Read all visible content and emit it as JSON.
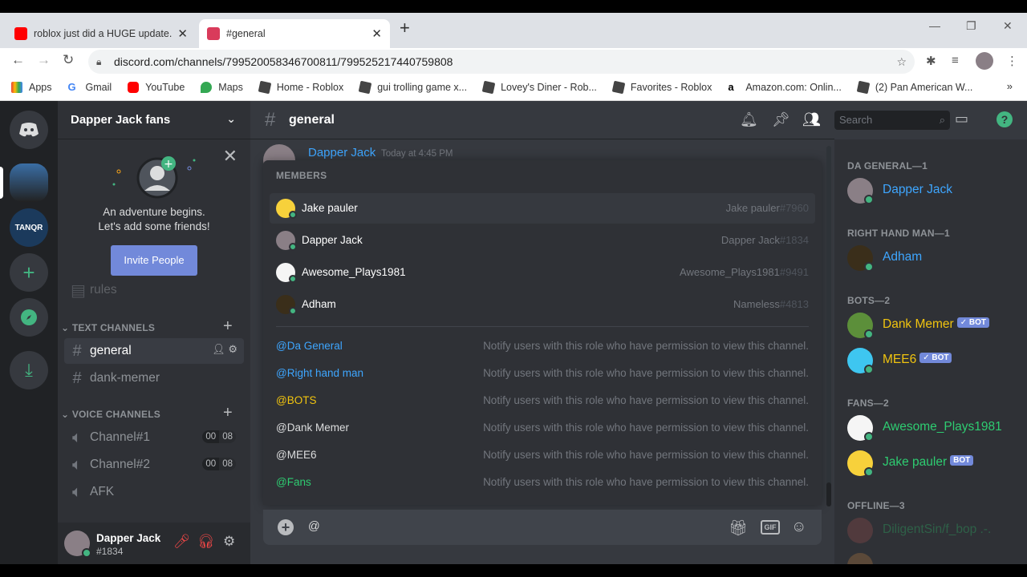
{
  "browser": {
    "tabs": [
      {
        "title": "roblox just did a HUGE update...",
        "favicon_color": "#ff0000",
        "active": false
      },
      {
        "title": "#general",
        "favicon_color": "#d93b5b",
        "active": true
      }
    ],
    "url": "discord.com/channels/799520058346700811/799525217440759808",
    "bookmarks": [
      "Apps",
      "Gmail",
      "YouTube",
      "Maps",
      "Home - Roblox",
      "gui trolling game x...",
      "Lovey's Diner - Rob...",
      "Favorites - Roblox",
      "Amazon.com: Onlin...",
      "(2) Pan American W..."
    ],
    "bookmarks_more": "»"
  },
  "server": {
    "name": "Dapper Jack fans",
    "invite": {
      "line1": "An adventure begins.",
      "line2": "Let's add some friends!",
      "button": "Invite People"
    },
    "partial_channel": "rules",
    "text_category": "TEXT CHANNELS",
    "text_channels": [
      "general",
      "dank-memer"
    ],
    "voice_category": "VOICE CHANNELS",
    "voice_channels": [
      {
        "name": "Channel#1",
        "count_a": "00",
        "count_b": "08"
      },
      {
        "name": "Channel#2",
        "count_a": "00",
        "count_b": "08"
      },
      {
        "name": "AFK"
      }
    ]
  },
  "user": {
    "name": "Dapper Jack",
    "tag": "#1834"
  },
  "chat": {
    "channel": "general",
    "search_placeholder": "Search",
    "message": {
      "author": "Dapper Jack",
      "timestamp": "Today at 4:45 PM"
    },
    "input_value": "@"
  },
  "mention_popup": {
    "title": "MEMBERS",
    "members": [
      {
        "name": "Jake pauler",
        "user": "Jake pauler",
        "disc": "#7960"
      },
      {
        "name": "Dapper Jack",
        "user": "Dapper Jack",
        "disc": "#1834"
      },
      {
        "name": "Awesome_Plays1981",
        "user": "Awesome_Plays1981",
        "disc": "#9491"
      },
      {
        "name": "Adham",
        "user": "Nameless",
        "disc": "#4813"
      }
    ],
    "roles": [
      {
        "name": "@Da General",
        "desc": "Notify users with this role who have permission to view this channel.",
        "color": "#3ea6ff"
      },
      {
        "name": "@Right hand man",
        "desc": "Notify users with this role who have permission to view this channel.",
        "color": "#3ea6ff"
      },
      {
        "name": "@BOTS",
        "desc": "Notify users with this role who have permission to view this channel.",
        "color": "#f1c40f"
      },
      {
        "name": "@Dank Memer",
        "desc": "Notify users with this role who have permission to view this channel.",
        "color": "#dcddde"
      },
      {
        "name": "@MEE6",
        "desc": "Notify users with this role who have permission to view this channel.",
        "color": "#dcddde"
      },
      {
        "name": "@Fans",
        "desc": "Notify users with this role who have permission to view this channel.",
        "color": "#2ecc71"
      }
    ]
  },
  "member_list": {
    "groups": [
      {
        "header": "DA GENERAL—1",
        "members": [
          {
            "name": "Dapper Jack",
            "color": "#3ea6ff"
          }
        ]
      },
      {
        "header": "RIGHT HAND MAN—1",
        "members": [
          {
            "name": "Adham",
            "color": "#3ea6ff"
          }
        ]
      },
      {
        "header": "BOTS—2",
        "members": [
          {
            "name": "Dank Memer",
            "color": "#f1c40f",
            "badge": "✓ BOT"
          },
          {
            "name": "MEE6",
            "color": "#f1c40f",
            "badge": "✓ BOT"
          }
        ]
      },
      {
        "header": "FANS—2",
        "members": [
          {
            "name": "Awesome_Plays1981",
            "color": "#2ecc71"
          },
          {
            "name": "Jake pauler",
            "color": "#2ecc71",
            "badge": "BOT"
          }
        ]
      },
      {
        "header": "OFFLINE—3",
        "members": [
          {
            "name": "DiligentSin/f_bop .-.",
            "color": "#2ecc71"
          }
        ]
      }
    ]
  }
}
